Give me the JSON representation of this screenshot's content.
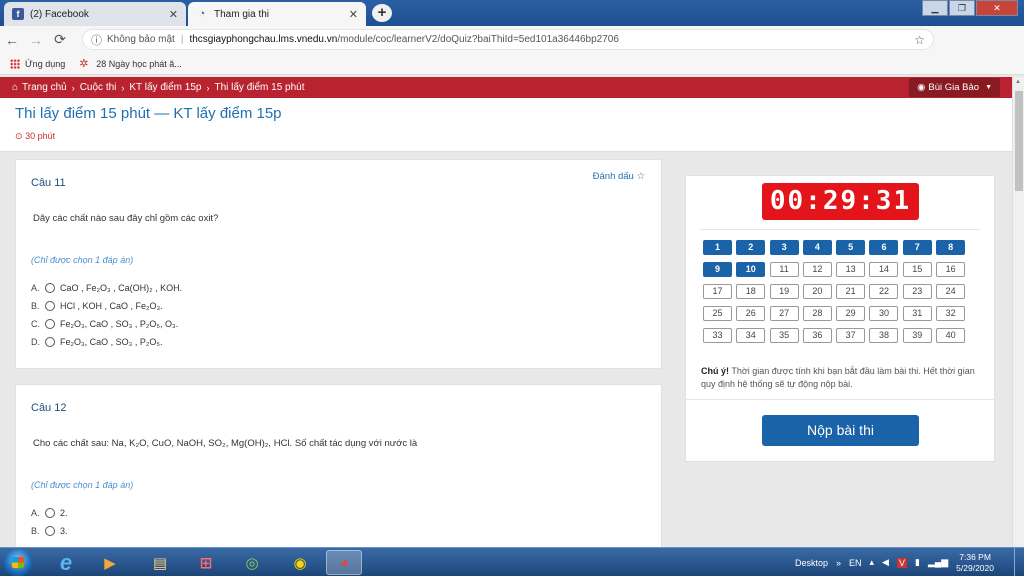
{
  "browser": {
    "tabs": [
      {
        "label": "(2) Facebook",
        "icon": "facebook-icon"
      },
      {
        "label": "Tham gia thi",
        "icon": "lms-icon"
      }
    ],
    "security_label": "Không bảo mật",
    "url_host": "thcsgiayphongchau.lms.vnedu.vn",
    "url_path": "/module/coc/learnerV2/doQuiz?baiThiId=5ed101a36446bp2706",
    "bookmarks": [
      {
        "label": "Ứng dụng",
        "icon": "apps-grid-icon"
      },
      {
        "label": "28 Ngày học phát ă...",
        "icon": "star-icon"
      }
    ]
  },
  "breadcrumb": {
    "items": [
      "Trang chủ",
      "Cuộc thi",
      "KT lấy điểm 15p",
      "Thi lấy điểm 15 phút"
    ]
  },
  "user": {
    "name": "Bùi Gia Bảo"
  },
  "page": {
    "title": "Thi lấy điểm 15 phút — KT lấy điểm 15p",
    "duration": "30 phút"
  },
  "questions": [
    {
      "heading": "Câu 11",
      "mark_label": "Đánh dấu ☆",
      "text": "Dãy các chất nào sau đây chỉ gồm các oxit?",
      "hint": "(Chỉ được chọn 1 đáp án)",
      "options": [
        {
          "letter": "A.",
          "text": "CaO , Fe₂O₃ , Ca(OH)₂ , KOH."
        },
        {
          "letter": "B.",
          "text": "HCl , KOH , CaO , Fe₂O₃."
        },
        {
          "letter": "C.",
          "text": "Fe₂O₃, CaO , SO₃ , P₂O₅, O₃."
        },
        {
          "letter": "D.",
          "text": "Fe₂O₃, CaO , SO₃ , P₂O₅."
        }
      ]
    },
    {
      "heading": "Câu 12",
      "text": "Cho các chất sau: Na, K₂O, CuO, NaOH, SO₂, Mg(OH)₂, HCl. Số chất tác dụng với nước là",
      "hint": "(Chỉ được chọn 1 đáp án)",
      "options": [
        {
          "letter": "A.",
          "text": "2."
        },
        {
          "letter": "B.",
          "text": "3."
        }
      ]
    }
  ],
  "panel": {
    "timer": "00:29:31",
    "question_numbers": [
      "1",
      "2",
      "3",
      "4",
      "5",
      "6",
      "7",
      "8",
      "9",
      "10",
      "11",
      "12",
      "13",
      "14",
      "15",
      "16",
      "17",
      "18",
      "19",
      "20",
      "21",
      "22",
      "23",
      "24",
      "25",
      "26",
      "27",
      "28",
      "29",
      "30",
      "31",
      "32",
      "33",
      "34",
      "35",
      "36",
      "37",
      "38",
      "39",
      "40"
    ],
    "answered_count": 10,
    "note_bold": "Chú ý!",
    "note_text": " Thời gian được tính khi bạn bắt đầu làm bài thi. Hết thời gian quy định hệ thống sẽ tự động nộp bài.",
    "submit_label": "Nộp bài thi"
  },
  "taskbar": {
    "desktop_label": "Desktop",
    "language": "EN",
    "time": "7:36 PM",
    "date": "5/29/2020"
  },
  "colors": {
    "accent_blue": "#1a63a8",
    "header_red": "#b8232f",
    "timer_red": "#e4141b",
    "hint_blue": "#4a8fcf"
  }
}
